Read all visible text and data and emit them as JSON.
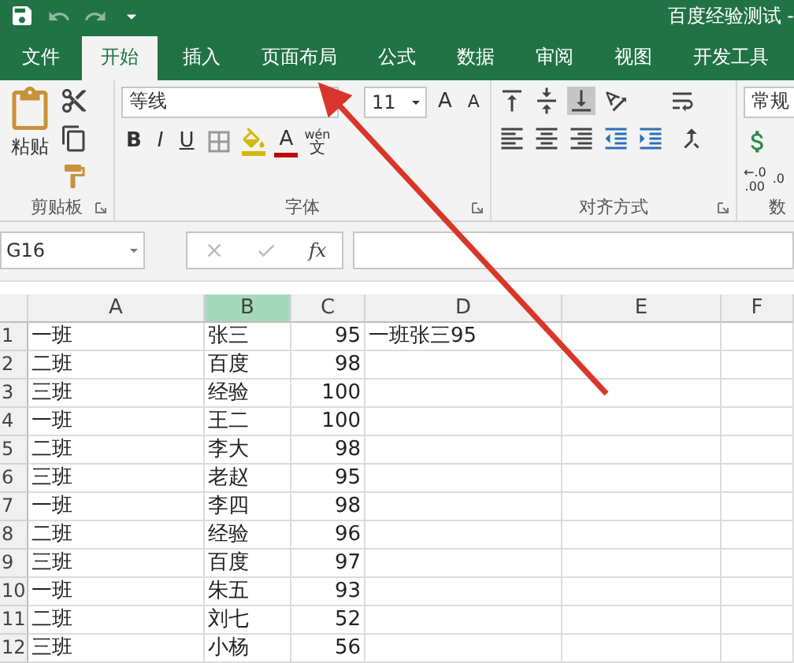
{
  "window": {
    "title": "百度经验测试 -"
  },
  "tabs": [
    {
      "label": "文件",
      "selected": false
    },
    {
      "label": "开始",
      "selected": true
    },
    {
      "label": "插入",
      "selected": false
    },
    {
      "label": "页面布局",
      "selected": false
    },
    {
      "label": "公式",
      "selected": false
    },
    {
      "label": "数据",
      "selected": false
    },
    {
      "label": "审阅",
      "selected": false
    },
    {
      "label": "视图",
      "selected": false
    },
    {
      "label": "开发工具",
      "selected": false
    }
  ],
  "ribbon": {
    "clipboard": {
      "paste": "粘贴",
      "label": "剪贴板"
    },
    "font": {
      "name": "等线",
      "size": "11",
      "grow": "A",
      "shrink": "A",
      "bold": "B",
      "italic": "I",
      "underline": "U",
      "font_color": "A",
      "phonetic_top": "wén",
      "phonetic_base": "文",
      "label": "字体"
    },
    "alignment": {
      "label": "对齐方式"
    },
    "number": {
      "format": "常规",
      "dec_top": "←.0",
      "dec_bottom": ".00",
      "dec2_top": ".0",
      "label": "数"
    }
  },
  "formula_bar": {
    "name_box": "G16",
    "fx": "fx"
  },
  "columns": [
    {
      "label": "A",
      "selected": false
    },
    {
      "label": "B",
      "selected": true
    },
    {
      "label": "C",
      "selected": false
    },
    {
      "label": "D",
      "selected": false
    },
    {
      "label": "E",
      "selected": false
    },
    {
      "label": "F",
      "selected": false
    }
  ],
  "rows": [
    {
      "num": "1",
      "cells": [
        "一班",
        "张三",
        "95",
        "一班张三95"
      ]
    },
    {
      "num": "2",
      "cells": [
        "二班",
        "百度",
        "98",
        ""
      ]
    },
    {
      "num": "3",
      "cells": [
        "三班",
        "经验",
        "100",
        ""
      ]
    },
    {
      "num": "4",
      "cells": [
        "一班",
        "王二",
        "100",
        ""
      ]
    },
    {
      "num": "5",
      "cells": [
        "二班",
        "李大",
        "98",
        ""
      ]
    },
    {
      "num": "6",
      "cells": [
        "三班",
        "老赵",
        "95",
        ""
      ]
    },
    {
      "num": "7",
      "cells": [
        "一班",
        "李四",
        "98",
        ""
      ]
    },
    {
      "num": "8",
      "cells": [
        "二班",
        "经验",
        "96",
        ""
      ]
    },
    {
      "num": "9",
      "cells": [
        "三班",
        "百度",
        "97",
        ""
      ]
    },
    {
      "num": "10",
      "cells": [
        "一班",
        "朱五",
        "93",
        ""
      ]
    },
    {
      "num": "11",
      "cells": [
        "二班",
        "刘七",
        "52",
        ""
      ]
    },
    {
      "num": "12",
      "cells": [
        "三班",
        "小杨",
        "56",
        ""
      ]
    }
  ]
}
